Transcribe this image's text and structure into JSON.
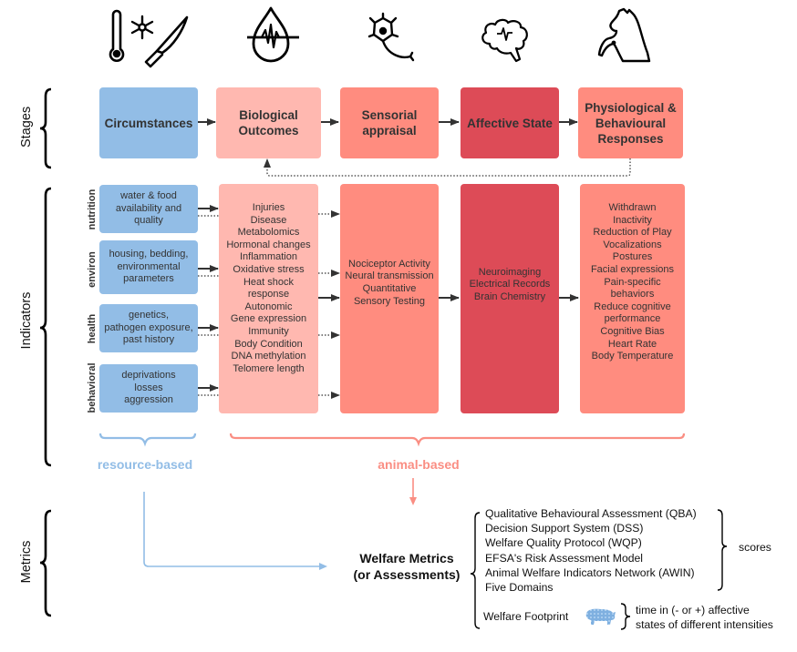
{
  "icons": [
    {
      "name": "thermometer-snowflake-knife-icon",
      "label": "circumstances"
    },
    {
      "name": "blood-drop-pulse-icon",
      "label": "biological"
    },
    {
      "name": "neuron-icon",
      "label": "sensorial"
    },
    {
      "name": "brain-pulse-icon",
      "label": "affective"
    },
    {
      "name": "horse-rearing-icon",
      "label": "responses"
    }
  ],
  "rows": {
    "stages": "Stages",
    "indicators": "Indicators",
    "metrics": "Metrics"
  },
  "colors": {
    "circumstances": "#92bde6",
    "biological": "#ffb8b0",
    "sensorial": "#ff8c7f",
    "affective": "#dd4b57",
    "responses": "#ff8c7f",
    "resource_label": "#92bde6",
    "animal_label": "#fa8e83"
  },
  "stages": [
    {
      "title": "Circumstances"
    },
    {
      "title": "Biological\nOutcomes"
    },
    {
      "title": "Sensorial\nappraisal"
    },
    {
      "title": "Affective State"
    },
    {
      "title": "Physiological &\nBehavioural\nResponses"
    }
  ],
  "resources": [
    {
      "category": "nutrition",
      "text": "water & food\navailability and\nquality"
    },
    {
      "category": "environ",
      "text": "housing, bedding,\nenvironmental\nparameters"
    },
    {
      "category": "health",
      "text": "genetics,\npathogen exposure,\npast history"
    },
    {
      "category": "behavioral",
      "text": "deprivations\nlosses\naggression"
    }
  ],
  "indicators": {
    "biological": "Injuries\nDisease\nMetabolomics\nHormonal changes\nInflammation\nOxidative stress\nHeat shock\nresponse\nAutonomic\nGene expression\nImmunity\nBody Condition\nDNA methylation\nTelomere length",
    "sensorial": "Nociceptor Activity\nNeural transmission\nQuantitative\nSensory Testing",
    "affective": "Neuroimaging\nElectrical Records\nBrain Chemistry",
    "responses": "Withdrawn\nInactivity\nReduction of Play\nVocalizations\nPostures\nFacial expressions\nPain-specific\nbehaviors\nReduce cognitive\nperformance\nCognitive Bias\nHeart Rate\nBody Temperature"
  },
  "groups": {
    "resource_based": "resource-based",
    "animal_based": "animal-based"
  },
  "metrics": {
    "title_line1": "Welfare Metrics",
    "title_line2": "(or Assessments)",
    "items": [
      "Qualitative Behavioural Assessment (QBA)",
      "Decision Support System (DSS)",
      "Welfare Quality Protocol (WQP)",
      "EFSA's Risk Assessment Model",
      "Animal Welfare Indicators Network (AWIN)",
      "Five Domains"
    ],
    "scores_label": "scores",
    "footprint_label": "Welfare Footprint",
    "footprint_icon": "pig-icon",
    "footprint_desc_line1": "time in (- or +) affective",
    "footprint_desc_line2": "states of different intensities"
  }
}
